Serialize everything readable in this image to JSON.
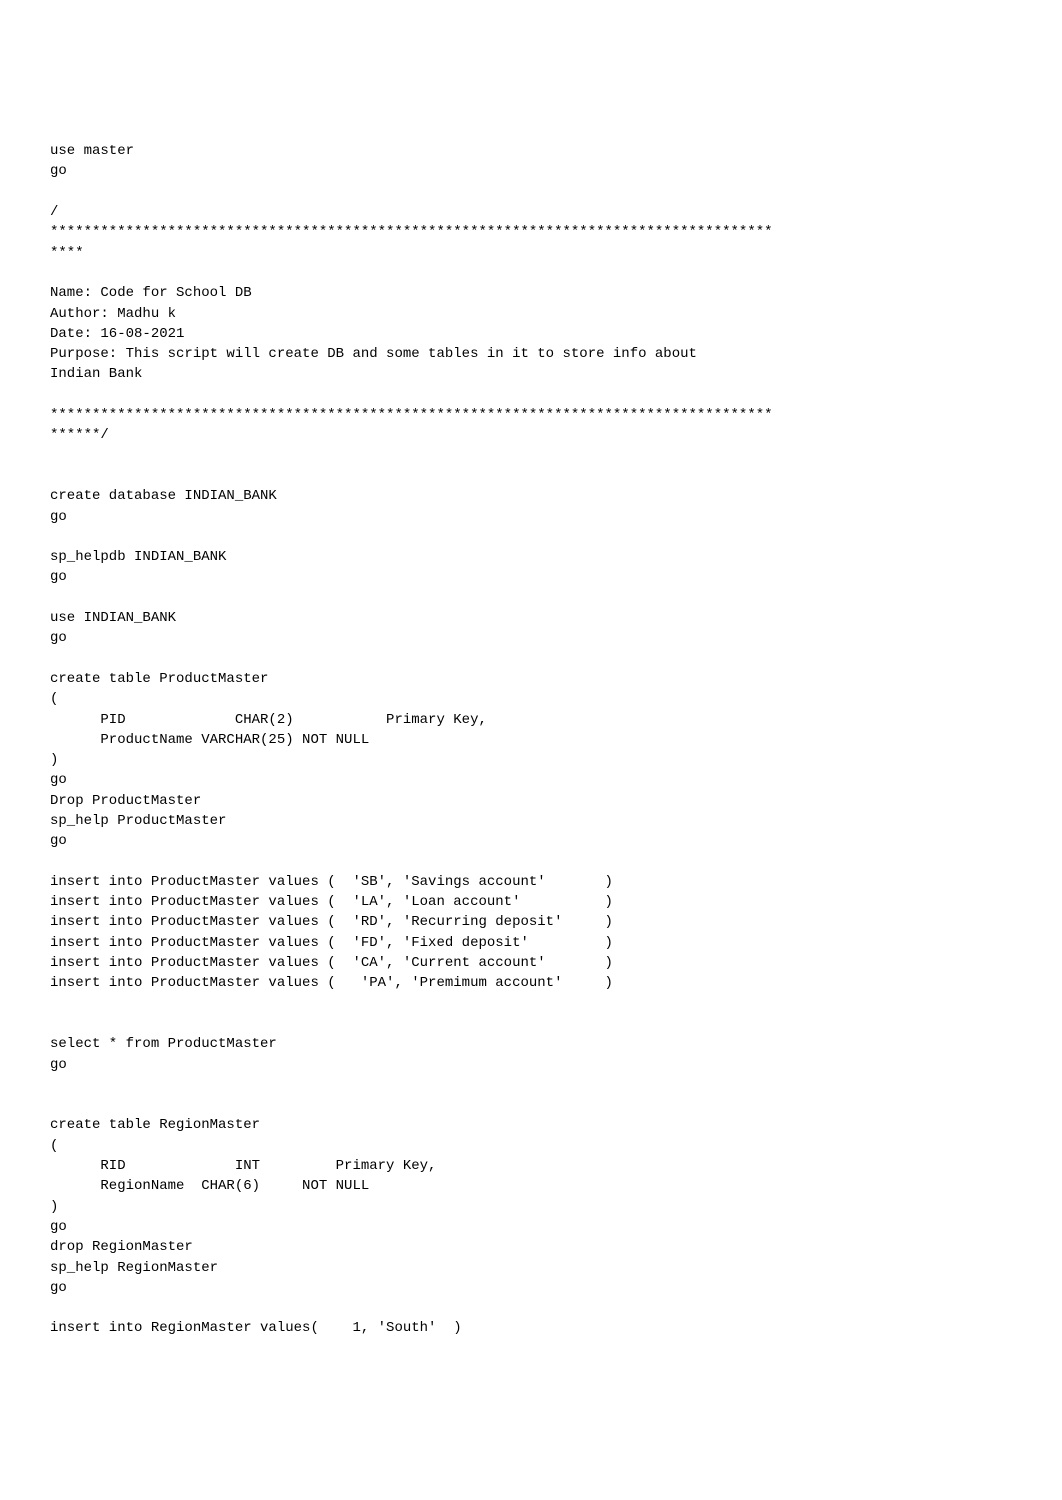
{
  "lines": [
    "use master",
    "go",
    "",
    "/",
    "**************************************************************************************",
    "****",
    "",
    "Name: Code for School DB",
    "Author: Madhu k",
    "Date: 16-08-2021",
    "Purpose: This script will create DB and some tables in it to store info about ",
    "Indian Bank",
    "",
    "**************************************************************************************",
    "******/",
    "",
    "",
    "create database INDIAN_BANK",
    "go",
    "",
    "sp_helpdb INDIAN_BANK",
    "go",
    "",
    "use INDIAN_BANK",
    "go",
    "",
    "create table ProductMaster",
    "(",
    "      PID             CHAR(2)           Primary Key,",
    "      ProductName VARCHAR(25) NOT NULL",
    ")",
    "go",
    "Drop ProductMaster",
    "sp_help ProductMaster",
    "go",
    "",
    "insert into ProductMaster values (  'SB', 'Savings account'       )",
    "insert into ProductMaster values (  'LA', 'Loan account'          )",
    "insert into ProductMaster values (  'RD', 'Recurring deposit'     )",
    "insert into ProductMaster values (  'FD', 'Fixed deposit'         )",
    "insert into ProductMaster values (  'CA', 'Current account'       )",
    "insert into ProductMaster values (   'PA', 'Premimum account'     )",
    "",
    "",
    "select * from ProductMaster",
    "go",
    "",
    "",
    "create table RegionMaster",
    "(",
    "      RID             INT         Primary Key,",
    "      RegionName  CHAR(6)     NOT NULL",
    ")",
    "go",
    "drop RegionMaster",
    "sp_help RegionMaster",
    "go",
    "",
    "insert into RegionMaster values(    1, 'South'  )"
  ]
}
